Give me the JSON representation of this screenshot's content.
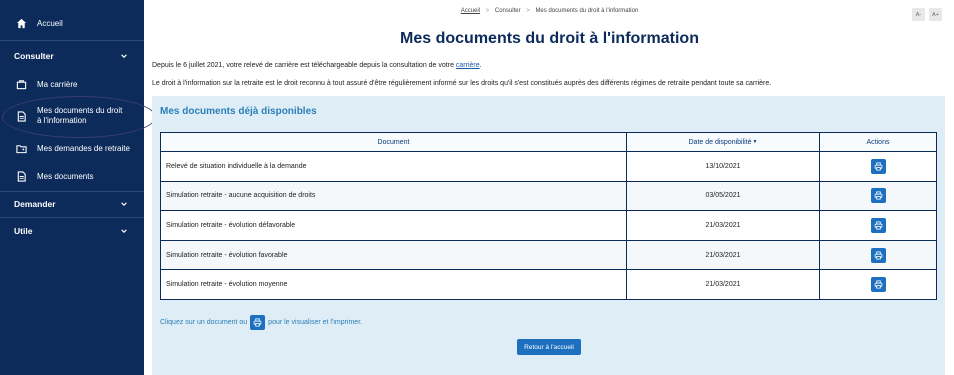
{
  "sidebar": {
    "home_label": "Accueil",
    "section_consulter": "Consulter",
    "item_carriere": "Ma carrière",
    "item_documents_droit": "Mes documents du droit à l'information",
    "item_demandes_retraite": "Mes demandes de retraite",
    "item_mes_documents": "Mes documents",
    "section_demander": "Demander",
    "section_utile": "Utile"
  },
  "breadcrumb": {
    "home": "Accueil",
    "consulter": "Consulter",
    "current": "Mes documents du droit à l'information",
    "separator": ">"
  },
  "font_controls": {
    "decrease": "A-",
    "increase": "A+"
  },
  "page_title": "Mes documents du droit à l'information",
  "intro": {
    "line1_prefix": "Depuis le 6 juillet 2021, votre relevé de carrière est téléchargeable depuis la consultation de votre ",
    "line1_link": "carrière",
    "line1_suffix": ".",
    "line2": "Le droit à l'information sur la retraite est le droit reconnu à tout assuré d'être régulièrement informé sur les droits qu'il s'est constitués auprès des différents régimes de retraite pendant toute sa carrière."
  },
  "panel": {
    "title": "Mes documents déjà disponibles",
    "table": {
      "headers": {
        "document": "Document",
        "date": "Date de disponibilité",
        "actions": "Actions"
      },
      "rows": [
        {
          "document": "Relevé de situation individuelle à la demande",
          "date": "13/10/2021"
        },
        {
          "document": "Simulation retraite - aucune acquisition de droits",
          "date": "03/05/2021"
        },
        {
          "document": "Simulation retraite - évolution défavorable",
          "date": "21/03/2021"
        },
        {
          "document": "Simulation retraite - évolution favorable",
          "date": "21/03/2021"
        },
        {
          "document": "Simulation retraite - évolution moyenne",
          "date": "21/03/2021"
        }
      ]
    },
    "hint_prefix": "Cliquez sur un document ou",
    "hint_suffix": "pour le visualiser et l'imprimer.",
    "back_button": "Retour à l'accueil"
  },
  "colors": {
    "sidebar_bg": "#0c2b5b",
    "title": "#0c2b5b",
    "panel_bg": "#dfeef6",
    "accent": "#1d6fbf",
    "panel_title": "#2a7fb8"
  },
  "icons": {
    "home": "home-icon",
    "briefcase": "briefcase-icon",
    "document": "document-icon",
    "folder": "folder-icon",
    "chevron": "chevron-down-icon",
    "print": "print-icon"
  }
}
